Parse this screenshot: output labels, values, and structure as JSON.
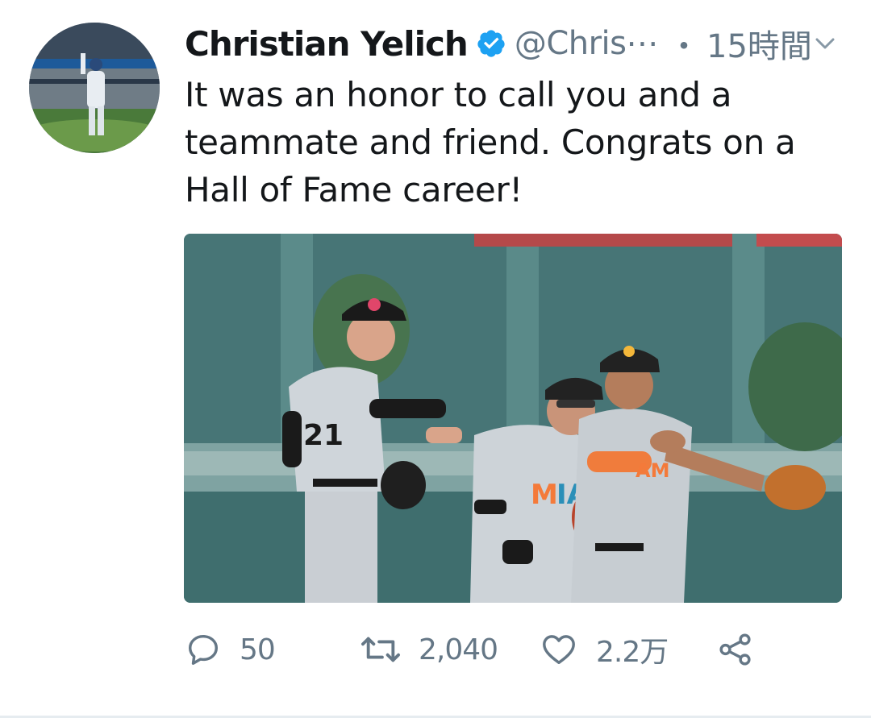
{
  "user": {
    "display_name": "Christian Yelich",
    "verified_icon": "verified-badge-icon",
    "handle": "@Chris⋯",
    "separator": "・",
    "time": "15時間"
  },
  "tweet": {
    "text": "It was an honor to call you and a teammate and friend. Congrats on a Hall of Fame career!"
  },
  "media": {
    "jersey_number": "21",
    "team_text": "MIA"
  },
  "actions": {
    "reply_count": "50",
    "retweet_count": "2,040",
    "like_count": "2.2万"
  },
  "colors": {
    "text": "#14171a",
    "secondary": "#657786",
    "verified": "#1da1f2",
    "icon": "#657786"
  },
  "icons": [
    "verified-badge-icon",
    "chevron-down-icon",
    "reply-icon",
    "retweet-icon",
    "like-icon",
    "share-icon"
  ]
}
